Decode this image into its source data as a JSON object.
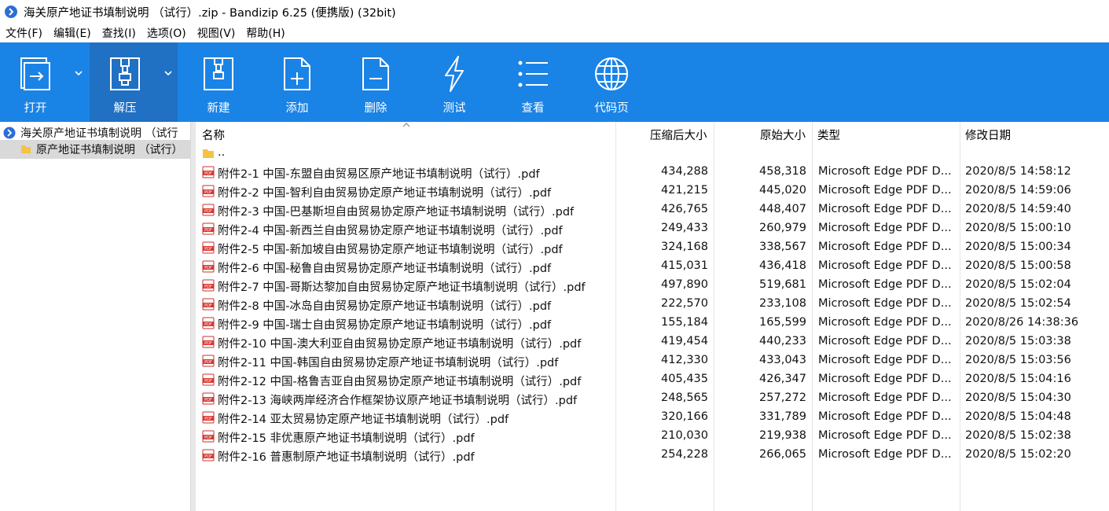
{
  "window": {
    "title": "海关原产地证书填制说明 （试行）.zip - Bandizip 6.25 (便携版) (32bit)"
  },
  "menu": [
    "文件(F)",
    "编辑(E)",
    "查找(I)",
    "选项(O)",
    "视图(V)",
    "帮助(H)"
  ],
  "toolbar": {
    "open": "打开",
    "extract": "解压",
    "new": "新建",
    "add": "添加",
    "delete": "删除",
    "test": "测试",
    "view": "查看",
    "codepage": "代码页"
  },
  "tree": {
    "root": "海关原产地证书填制说明 （试行",
    "child": "原产地证书填制说明 （试行）"
  },
  "columns": {
    "name": "名称",
    "compressed": "压缩后大小",
    "original": "原始大小",
    "type": "类型",
    "modified": "修改日期"
  },
  "parent_row": "..",
  "files": [
    {
      "name": "附件2-1 中国-东盟自由贸易区原产地证书填制说明（试行）.pdf",
      "csize": "434,288",
      "osize": "458,318",
      "type": "Microsoft Edge PDF D...",
      "date": "2020/8/5 14:58:12"
    },
    {
      "name": "附件2-2 中国-智利自由贸易协定原产地证书填制说明（试行）.pdf",
      "csize": "421,215",
      "osize": "445,020",
      "type": "Microsoft Edge PDF D...",
      "date": "2020/8/5 14:59:06"
    },
    {
      "name": "附件2-3 中国-巴基斯坦自由贸易协定原产地证书填制说明（试行）.pdf",
      "csize": "426,765",
      "osize": "448,407",
      "type": "Microsoft Edge PDF D...",
      "date": "2020/8/5 14:59:40"
    },
    {
      "name": "附件2-4 中国-新西兰自由贸易协定原产地证书填制说明（试行）.pdf",
      "csize": "249,433",
      "osize": "260,979",
      "type": "Microsoft Edge PDF D...",
      "date": "2020/8/5 15:00:10"
    },
    {
      "name": "附件2-5 中国-新加坡自由贸易协定原产地证书填制说明（试行）.pdf",
      "csize": "324,168",
      "osize": "338,567",
      "type": "Microsoft Edge PDF D...",
      "date": "2020/8/5 15:00:34"
    },
    {
      "name": "附件2-6 中国-秘鲁自由贸易协定原产地证书填制说明（试行）.pdf",
      "csize": "415,031",
      "osize": "436,418",
      "type": "Microsoft Edge PDF D...",
      "date": "2020/8/5 15:00:58"
    },
    {
      "name": "附件2-7 中国-哥斯达黎加自由贸易协定原产地证书填制说明（试行）.pdf",
      "csize": "497,890",
      "osize": "519,681",
      "type": "Microsoft Edge PDF D...",
      "date": "2020/8/5 15:02:04"
    },
    {
      "name": "附件2-8 中国-冰岛自由贸易协定原产地证书填制说明（试行）.pdf",
      "csize": "222,570",
      "osize": "233,108",
      "type": "Microsoft Edge PDF D...",
      "date": "2020/8/5 15:02:54"
    },
    {
      "name": "附件2-9 中国-瑞士自由贸易协定原产地证书填制说明（试行）.pdf",
      "csize": "155,184",
      "osize": "165,599",
      "type": "Microsoft Edge PDF D...",
      "date": "2020/8/26 14:38:36"
    },
    {
      "name": "附件2-10 中国-澳大利亚自由贸易协定原产地证书填制说明（试行）.pdf",
      "csize": "419,454",
      "osize": "440,233",
      "type": "Microsoft Edge PDF D...",
      "date": "2020/8/5 15:03:38"
    },
    {
      "name": "附件2-11 中国-韩国自由贸易协定原产地证书填制说明（试行）.pdf",
      "csize": "412,330",
      "osize": "433,043",
      "type": "Microsoft Edge PDF D...",
      "date": "2020/8/5 15:03:56"
    },
    {
      "name": "附件2-12 中国-格鲁吉亚自由贸易协定原产地证书填制说明（试行）.pdf",
      "csize": "405,435",
      "osize": "426,347",
      "type": "Microsoft Edge PDF D...",
      "date": "2020/8/5 15:04:16"
    },
    {
      "name": "附件2-13  海峡两岸经济合作框架协议原产地证书填制说明（试行）.pdf",
      "csize": "248,565",
      "osize": "257,272",
      "type": "Microsoft Edge PDF D...",
      "date": "2020/8/5 15:04:30"
    },
    {
      "name": "附件2-14 亚太贸易协定原产地证书填制说明（试行）.pdf",
      "csize": "320,166",
      "osize": "331,789",
      "type": "Microsoft Edge PDF D...",
      "date": "2020/8/5 15:04:48"
    },
    {
      "name": "附件2-15 非优惠原产地证书填制说明（试行）.pdf",
      "csize": "210,030",
      "osize": "219,938",
      "type": "Microsoft Edge PDF D...",
      "date": "2020/8/5 15:02:38"
    },
    {
      "name": "附件2-16 普惠制原产地证书填制说明（试行）.pdf",
      "csize": "254,228",
      "osize": "266,065",
      "type": "Microsoft Edge PDF D...",
      "date": "2020/8/5 15:02:20"
    }
  ]
}
